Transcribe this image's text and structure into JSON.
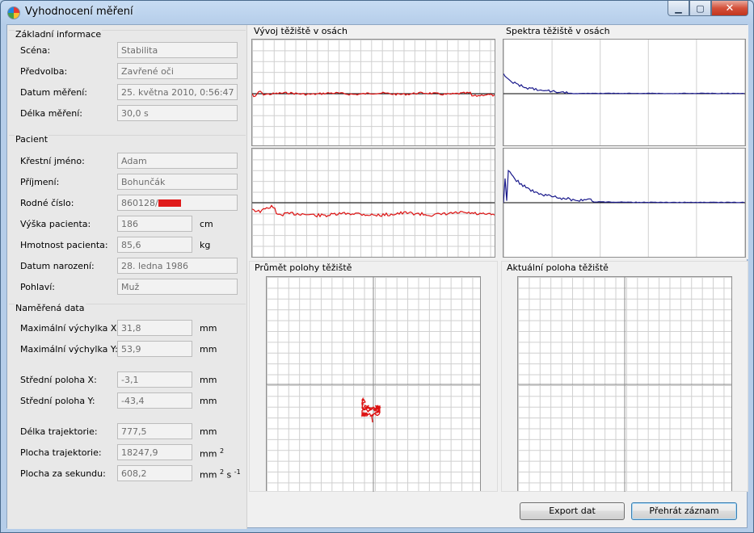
{
  "window": {
    "title": "Vyhodnocení měření",
    "min_glyph": "▁",
    "max_glyph": "▢",
    "close_glyph": "✕"
  },
  "basic_info": {
    "title": "Základní informace",
    "scene_label": "Scéna:",
    "scene_value": "Stabilita",
    "preset_label": "Předvolba:",
    "preset_value": "Zavřené oči",
    "date_label": "Datum měření:",
    "date_value": "25. května 2010, 0:56:47",
    "length_label": "Délka měření:",
    "length_value": "30,0 s"
  },
  "patient": {
    "title": "Pacient",
    "first_name_label": "Křestní jméno:",
    "first_name_value": "Adam",
    "surname_label": "Příjmení:",
    "surname_value": "Bohunčák",
    "birth_number_label": "Rodné číslo:",
    "birth_number_value": "860128/",
    "height_label": "Výška pacienta:",
    "height_value": "186",
    "height_unit": "cm",
    "weight_label": "Hmotnost pacienta:",
    "weight_value": "85,6",
    "weight_unit": "kg",
    "birth_date_label": "Datum narození:",
    "birth_date_value": "28. ledna 1986",
    "sex_label": "Pohlaví:",
    "sex_value": "Muž"
  },
  "measured": {
    "title": "Naměřená data",
    "max_x_label": "Maximální výchylka X:",
    "max_x_value": "31,8",
    "max_x_unit": "mm",
    "max_y_label": "Maximální výchylka Y:",
    "max_y_value": "53,9",
    "max_y_unit": "mm",
    "mean_x_label": "Střední poloha X:",
    "mean_x_value": "-3,1",
    "mean_x_unit": "mm",
    "mean_y_label": "Střední poloha Y:",
    "mean_y_value": "-43,4",
    "mean_y_unit": "mm",
    "traj_len_label": "Délka trajektorie:",
    "traj_len_value": "777,5",
    "traj_len_unit": "mm",
    "traj_area_label": "Plocha trajektorie:",
    "traj_area_value": "18247,9",
    "traj_area_unit": "mm",
    "traj_area_sup": "2",
    "area_per_sec_label": "Plocha za sekundu:",
    "area_per_sec_value": "608,2",
    "area_per_sec_unit_a": "mm",
    "area_per_sec_sup_a": "2",
    "area_per_sec_unit_b": "s",
    "area_per_sec_sup_b": "-1"
  },
  "graphs": {
    "cog_time_title": "Vývoj těžiště v osách",
    "spectra_title": "Spektra těžiště v osách",
    "avg_position_title": "Průmět polohy těžiště",
    "current_position_title": "Aktuální poloha těžiště"
  },
  "buttons": {
    "export_label": "Export dat",
    "play_label": "Přehrát záznam"
  },
  "colors": {
    "signal": "#dd1111",
    "spectrum": "#1a1a8c",
    "baseline": "#000000"
  }
}
